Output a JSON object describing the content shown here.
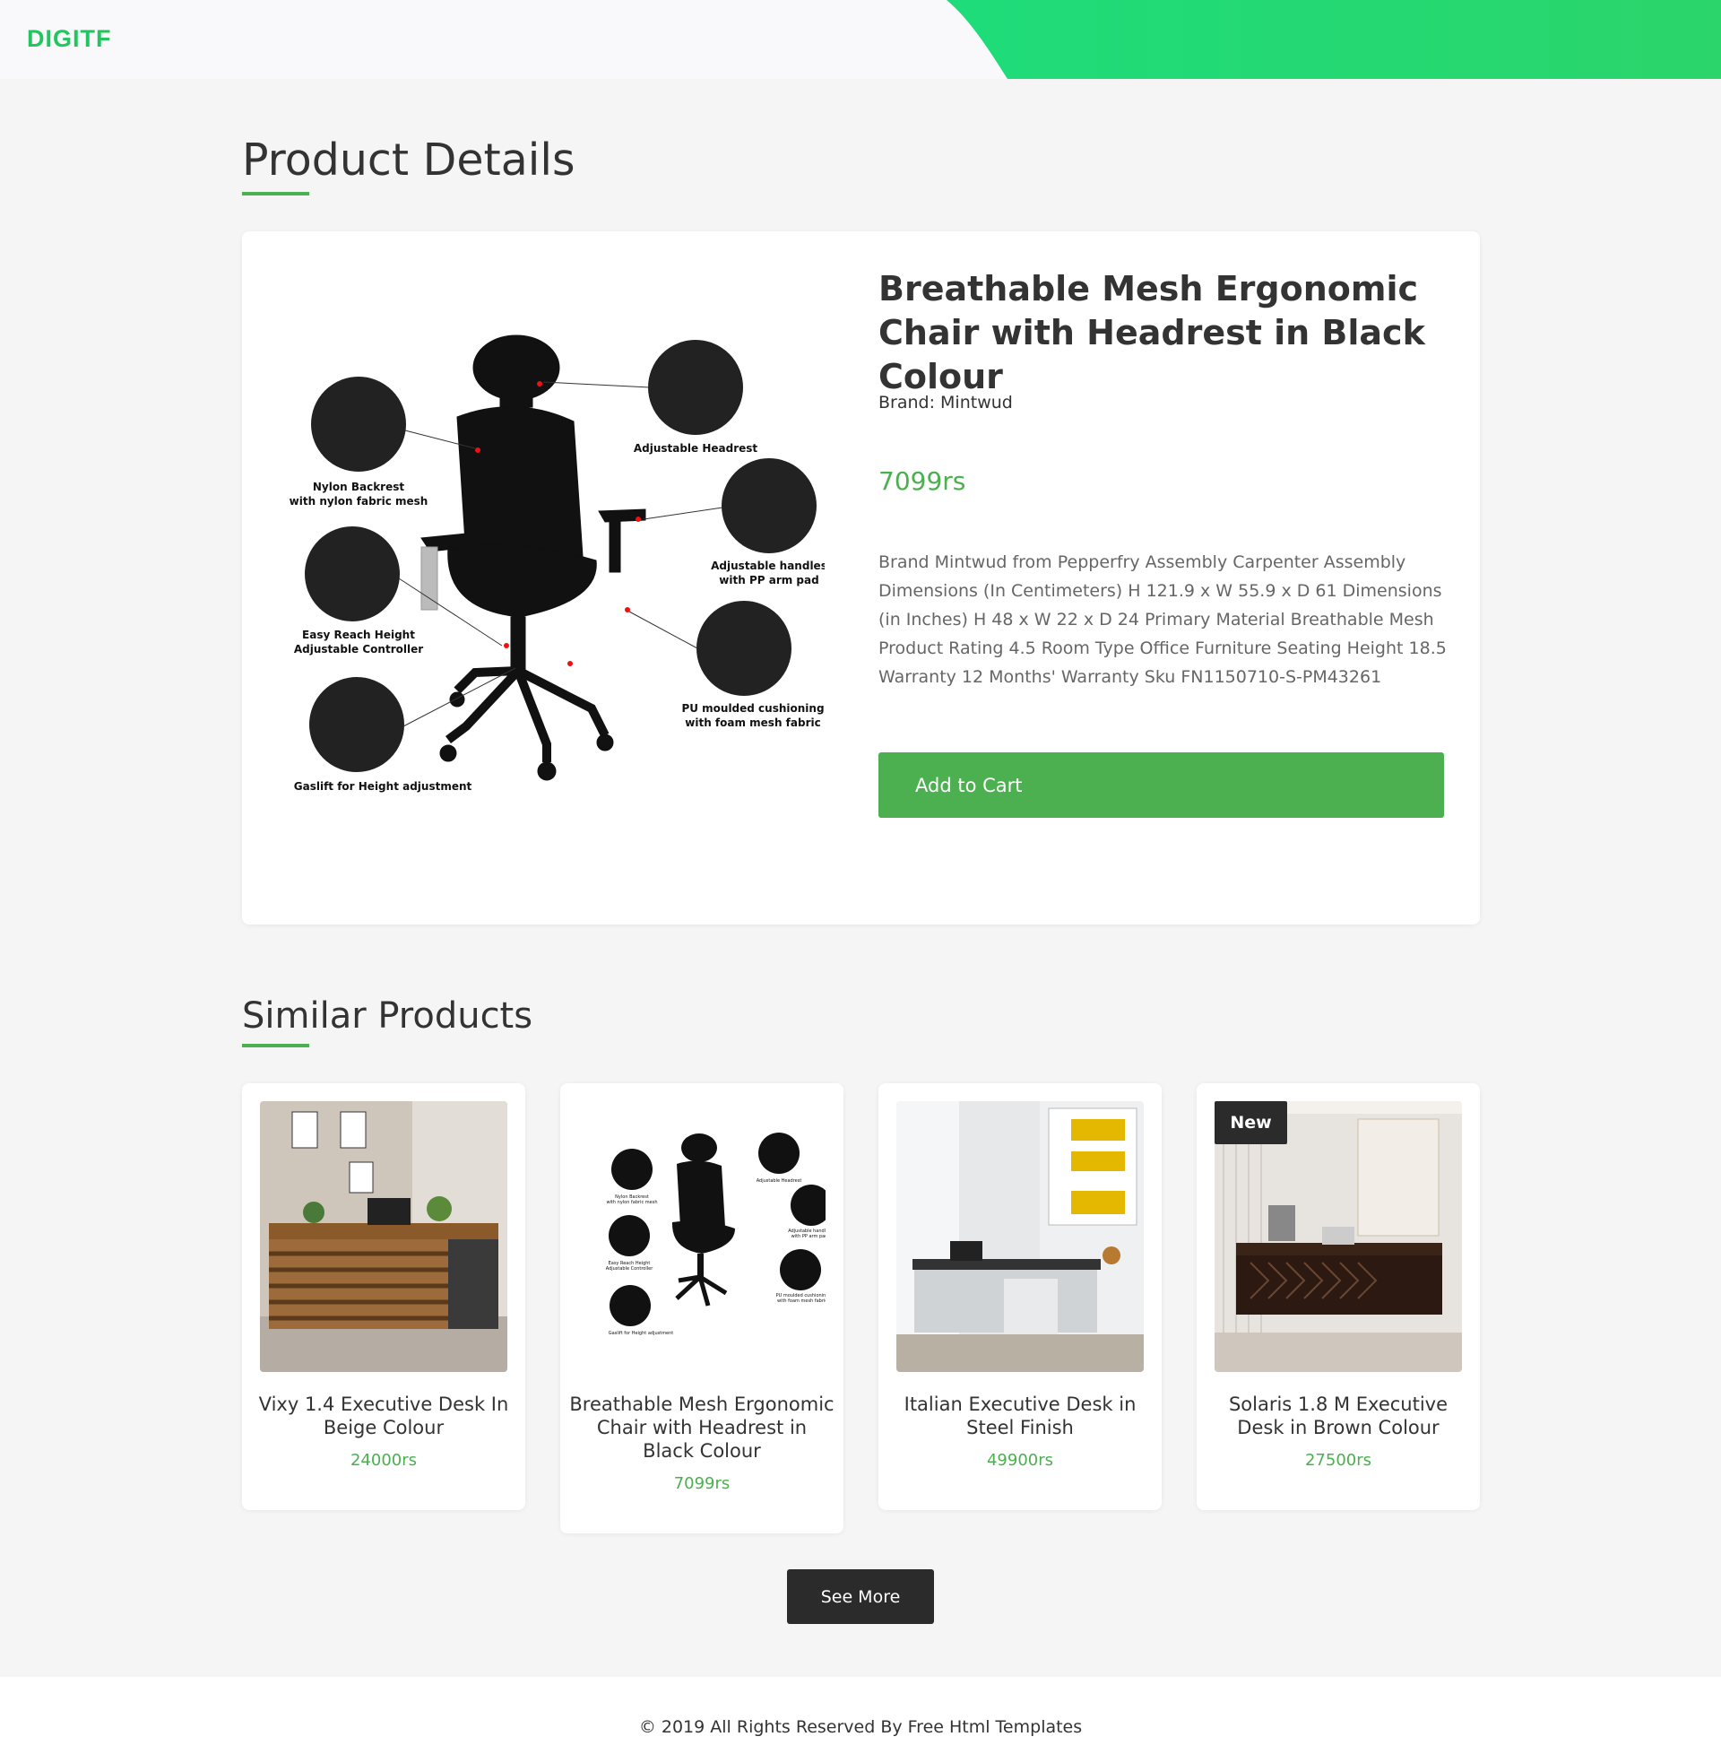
{
  "header": {
    "logo": "DIGITF"
  },
  "page": {
    "section_title": "Product Details",
    "similar_title": "Similar Products"
  },
  "colors": {
    "accent": "#4caf50",
    "brand": "#22c55e",
    "dark": "#2b2b2b"
  },
  "product": {
    "name": "Breathable Mesh Ergonomic Chair with Headrest in Black Colour",
    "brand": "Brand: Mintwud",
    "price": "7099rs",
    "description": "Brand Mintwud from Pepperfry Assembly Carpenter Assembly Dimensions (In Centimeters) H 121.9 x W 55.9 x D 61 Dimensions (in Inches) H 48 x W 22 x D 24 Primary Material Breathable Mesh Product Rating 4.5 Room Type Office Furniture Seating Height 18.5 Warranty 12 Months' Warranty Sku FN1150710-S-PM43261",
    "add_to_cart": "Add to Cart",
    "image_labels": {
      "headrest": "Adjustable Headrest",
      "backrest_1": "Nylon Backrest",
      "backrest_2": "with nylon fabric mesh",
      "handles_1": "Adjustable handles",
      "handles_2": "with PP arm pad",
      "controller_1": "Easy Reach Height",
      "controller_2": "Adjustable Controller",
      "cushion_1": "PU moulded cushioning",
      "cushion_2": "with foam mesh fabric",
      "gaslift": "Gaslift for Height adjustment"
    }
  },
  "similar": [
    {
      "name": "Vixy 1.4 Executive Desk In Beige Colour",
      "price": "24000rs"
    },
    {
      "name": "Breathable Mesh Ergonomic Chair with Headrest in Black Colour",
      "price": "7099rs"
    },
    {
      "name": "Italian Executive Desk in Steel Finish",
      "price": "49900rs"
    },
    {
      "name": "Solaris 1.8 M Executive Desk in Brown Colour",
      "price": "27500rs",
      "badge": "New"
    }
  ],
  "see_more": "See More",
  "footer": {
    "text": "© 2019 All Rights Reserved By Free Html Templates"
  }
}
